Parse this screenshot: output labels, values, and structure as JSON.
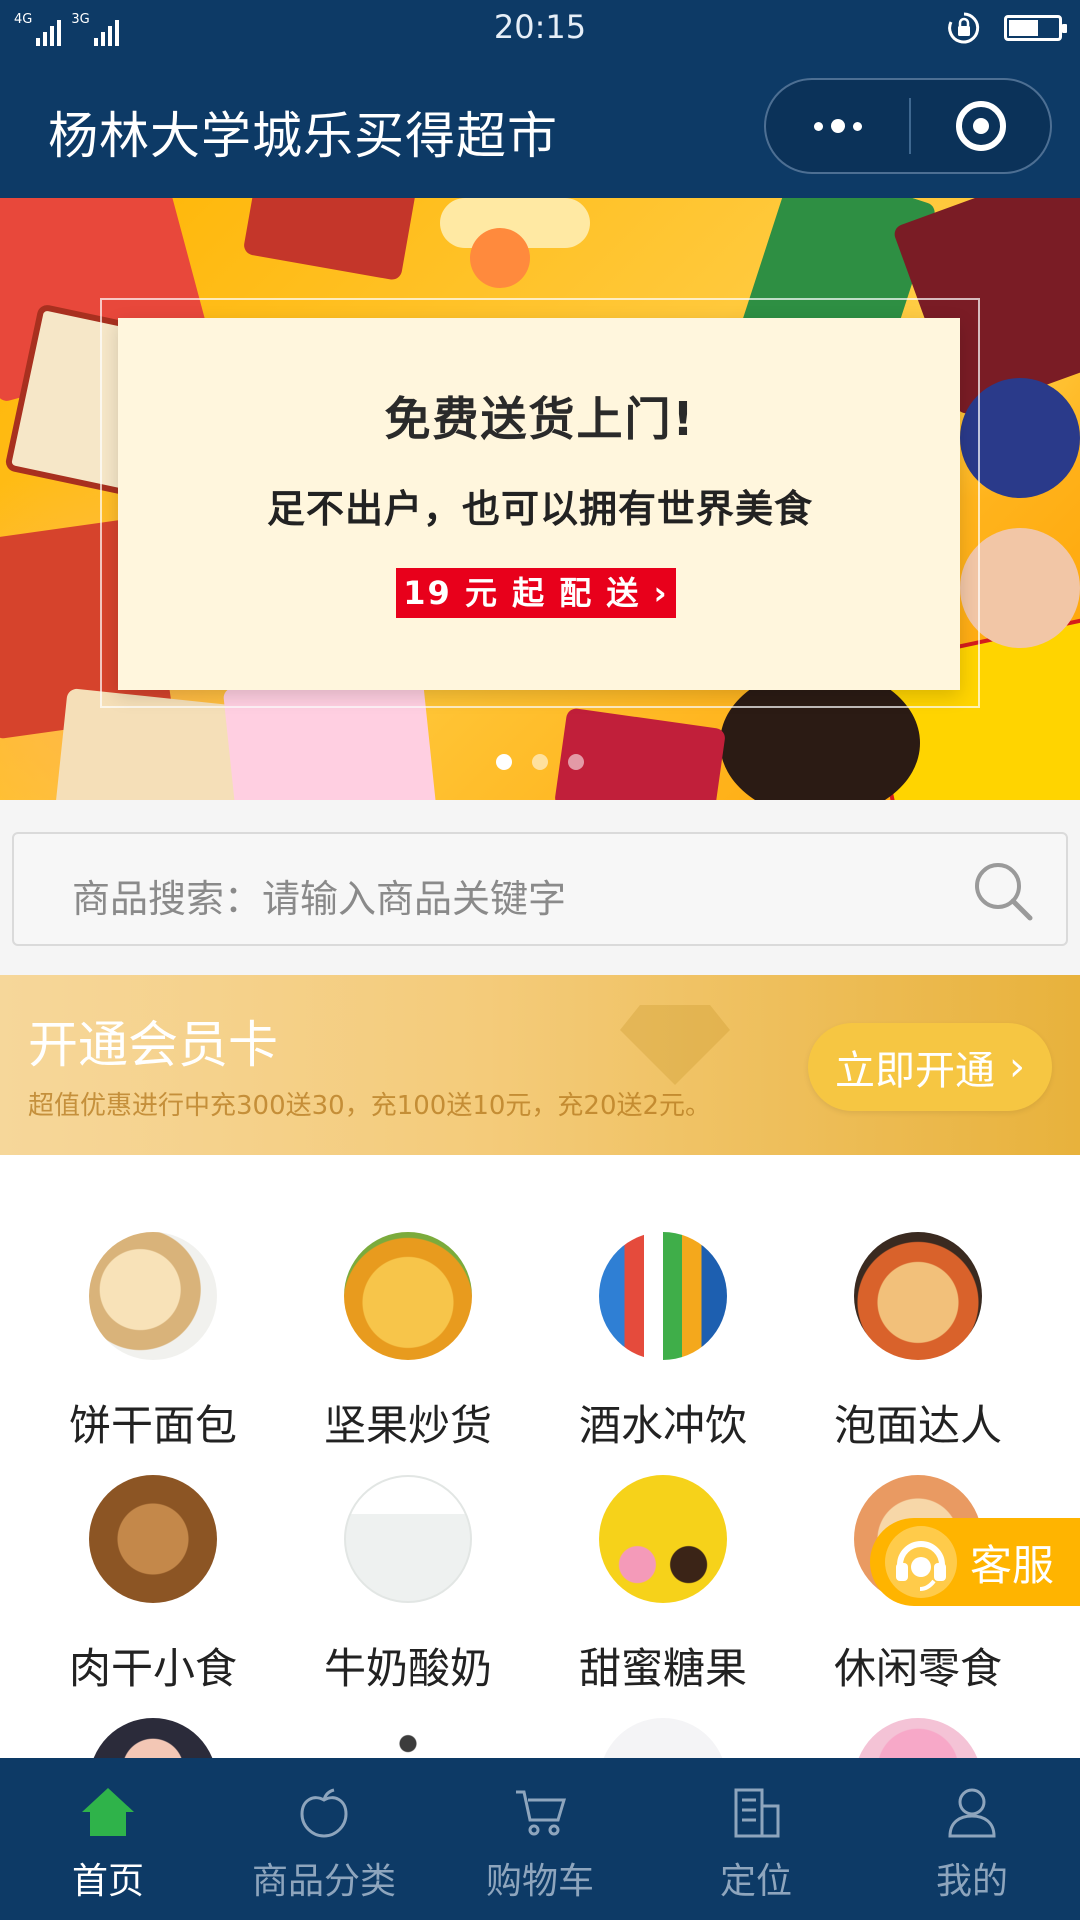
{
  "status_bar": {
    "network_1": "4G",
    "network_2": "3G",
    "time": "20:15",
    "battery_level": 0.6
  },
  "nav": {
    "title": "杨林大学城乐买得超市",
    "more_icon": "more-dots-icon",
    "close_icon": "target-close-icon"
  },
  "banner": {
    "headline": "免费送货上门!",
    "subline": "足不出户，也可以拥有世界美食",
    "badge": "19 元 起 配 送 ›",
    "slide_count": 3,
    "active_slide": 0
  },
  "search": {
    "placeholder": "商品搜索：请输入商品关键字",
    "icon": "search-icon"
  },
  "member": {
    "title": "开通会员卡",
    "description": "超值优惠进行中充300送30，充100送10元，充20送2元。",
    "button_label": "立即开通",
    "button_chevron": "›"
  },
  "categories": [
    {
      "label": "饼干面包",
      "icon": "bread-icon",
      "color": "#e9cfa3"
    },
    {
      "label": "坚果炒货",
      "icon": "chips-icon",
      "color": "#f2b22b"
    },
    {
      "label": "酒水冲饮",
      "icon": "drinks-icon",
      "color": "#2f7fd4"
    },
    {
      "label": "泡面达人",
      "icon": "noodles-icon",
      "color": "#d9823a"
    },
    {
      "label": "肉干小食",
      "icon": "jerky-icon",
      "color": "#a0662f"
    },
    {
      "label": "牛奶酸奶",
      "icon": "milk-icon",
      "color": "#eef1f0"
    },
    {
      "label": "甜蜜糖果",
      "icon": "candy-icon",
      "color": "#f6d21a"
    },
    {
      "label": "休闲零食",
      "icon": "snacks-icon",
      "color": "#f0b08a"
    }
  ],
  "customer_service": {
    "label": "客服",
    "icon": "headset-icon"
  },
  "tabbar": [
    {
      "label": "首页",
      "icon": "home-icon",
      "active": true
    },
    {
      "label": "商品分类",
      "icon": "apple-icon",
      "active": false
    },
    {
      "label": "购物车",
      "icon": "cart-icon",
      "active": false
    },
    {
      "label": "定位",
      "icon": "building-icon",
      "active": false
    },
    {
      "label": "我的",
      "icon": "user-icon",
      "active": false
    }
  ],
  "colors": {
    "primary": "#0d3a66",
    "accent": "#ffb400",
    "active_tab_icon": "#2fb34a",
    "badge_red": "#e8001b"
  }
}
